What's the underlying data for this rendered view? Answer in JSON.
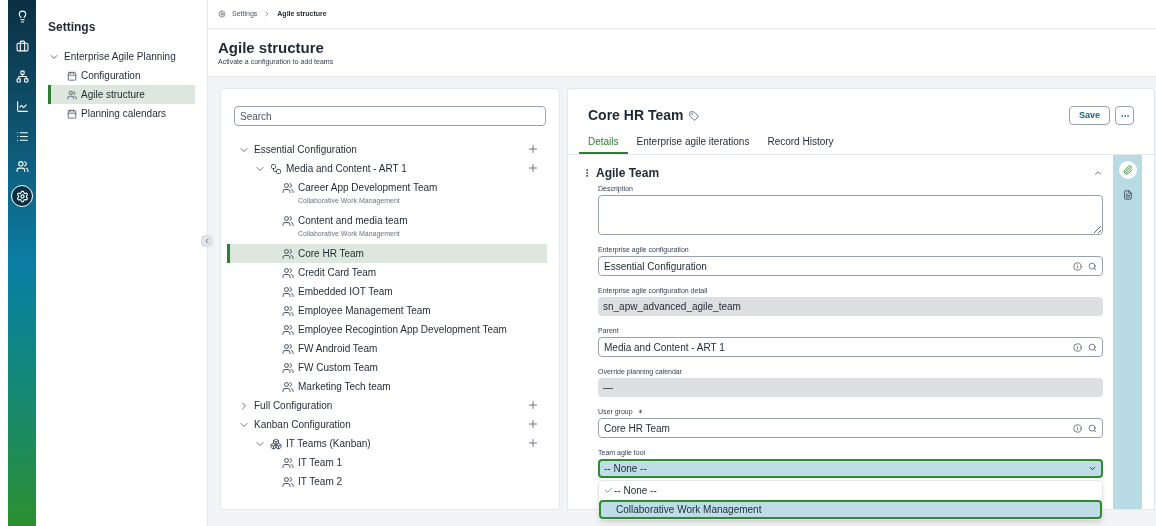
{
  "rail": [
    {
      "selected": false
    },
    {
      "selected": false
    },
    {
      "selected": false
    },
    {
      "selected": false
    },
    {
      "selected": false
    },
    {
      "selected": false
    },
    {
      "selected": true
    }
  ],
  "sidebar": {
    "title": "Settings",
    "group": {
      "label": "Enterprise Agile Planning",
      "expanded": true,
      "items": [
        {
          "label": "Configuration",
          "selected": false
        },
        {
          "label": "Agile structure",
          "selected": true
        },
        {
          "label": "Planning calendars",
          "selected": false
        }
      ]
    }
  },
  "breadcrumb": [
    {
      "label": "Settings"
    },
    {
      "label": "Agile structure"
    }
  ],
  "header": {
    "title": "Agile structure",
    "subtitle": "Activate a configuration to add teams"
  },
  "tree": {
    "search": {
      "placeholder": "Search"
    },
    "nodes": [
      {
        "label": "Essential Configuration",
        "kind": "config",
        "expanded": true,
        "selected": false,
        "children": [
          {
            "label": "Media and Content - ART 1",
            "kind": "art",
            "expanded": true,
            "selected": false,
            "children": [
              {
                "label": "Career App Development Team",
                "subtitle": "Collaborative Work Management",
                "kind": "team",
                "selected": false
              },
              {
                "label": "Content and media team",
                "subtitle": "Collaborative Work Management",
                "kind": "team",
                "selected": false
              },
              {
                "label": "Core HR Team",
                "kind": "team",
                "selected": true
              },
              {
                "label": "Credit Card Team",
                "kind": "team",
                "selected": false
              },
              {
                "label": "Embedded IOT Team",
                "kind": "team",
                "selected": false
              },
              {
                "label": "Employee Management Team",
                "kind": "team",
                "selected": false
              },
              {
                "label": "Employee Recogintion App Development Team",
                "kind": "team",
                "selected": false
              },
              {
                "label": "FW Android Team",
                "kind": "team",
                "selected": false
              },
              {
                "label": "FW Custom Team",
                "kind": "team",
                "selected": false
              },
              {
                "label": "Marketing Tech team",
                "kind": "team",
                "selected": false
              }
            ]
          }
        ]
      },
      {
        "label": "Full Configuration",
        "kind": "config",
        "expanded": false,
        "selected": false
      },
      {
        "label": "Kanban Configuration",
        "kind": "config",
        "expanded": true,
        "selected": false,
        "children": [
          {
            "label": "IT Teams (Kanban)",
            "kind": "kanban",
            "expanded": true,
            "selected": false,
            "children": [
              {
                "label": "IT Team 1",
                "kind": "team",
                "selected": false
              },
              {
                "label": "IT Team 2",
                "kind": "team",
                "selected": false
              }
            ]
          }
        ]
      }
    ]
  },
  "record": {
    "title": "Core HR Team",
    "save": "Save",
    "tabs": [
      {
        "label": "Details",
        "selected": true
      },
      {
        "label": "Enterprise agile iterations",
        "selected": false
      },
      {
        "label": "Record History",
        "selected": false
      }
    ],
    "section": {
      "title": "Agile Team",
      "expanded": true
    },
    "fields": [
      {
        "kind": "textarea",
        "label": "Description"
      },
      {
        "kind": "lookup",
        "label": "Enterprise agile configuration",
        "value": "Essential Configuration"
      },
      {
        "kind": "readonly",
        "label": "Enterprise agile configuration detail",
        "value": "sn_apw_advanced_agile_team"
      },
      {
        "kind": "lookup",
        "label": "Parent",
        "value": "Media and Content - ART 1"
      },
      {
        "kind": "readonly",
        "label": "Override planning calendar",
        "value": "—"
      },
      {
        "kind": "lookup",
        "label": "User group",
        "required": true,
        "value": "Core HR Team"
      },
      {
        "kind": "select",
        "label": "Team agile tool",
        "value": "-- None --",
        "open": true,
        "options": [
          {
            "label": "-- None --",
            "selected": true,
            "highlighted": false
          },
          {
            "label": "Collaborative Work Management",
            "selected": false,
            "highlighted": true
          }
        ]
      }
    ],
    "side_tools": [
      {
        "selected": true
      },
      {
        "selected": false
      }
    ]
  }
}
